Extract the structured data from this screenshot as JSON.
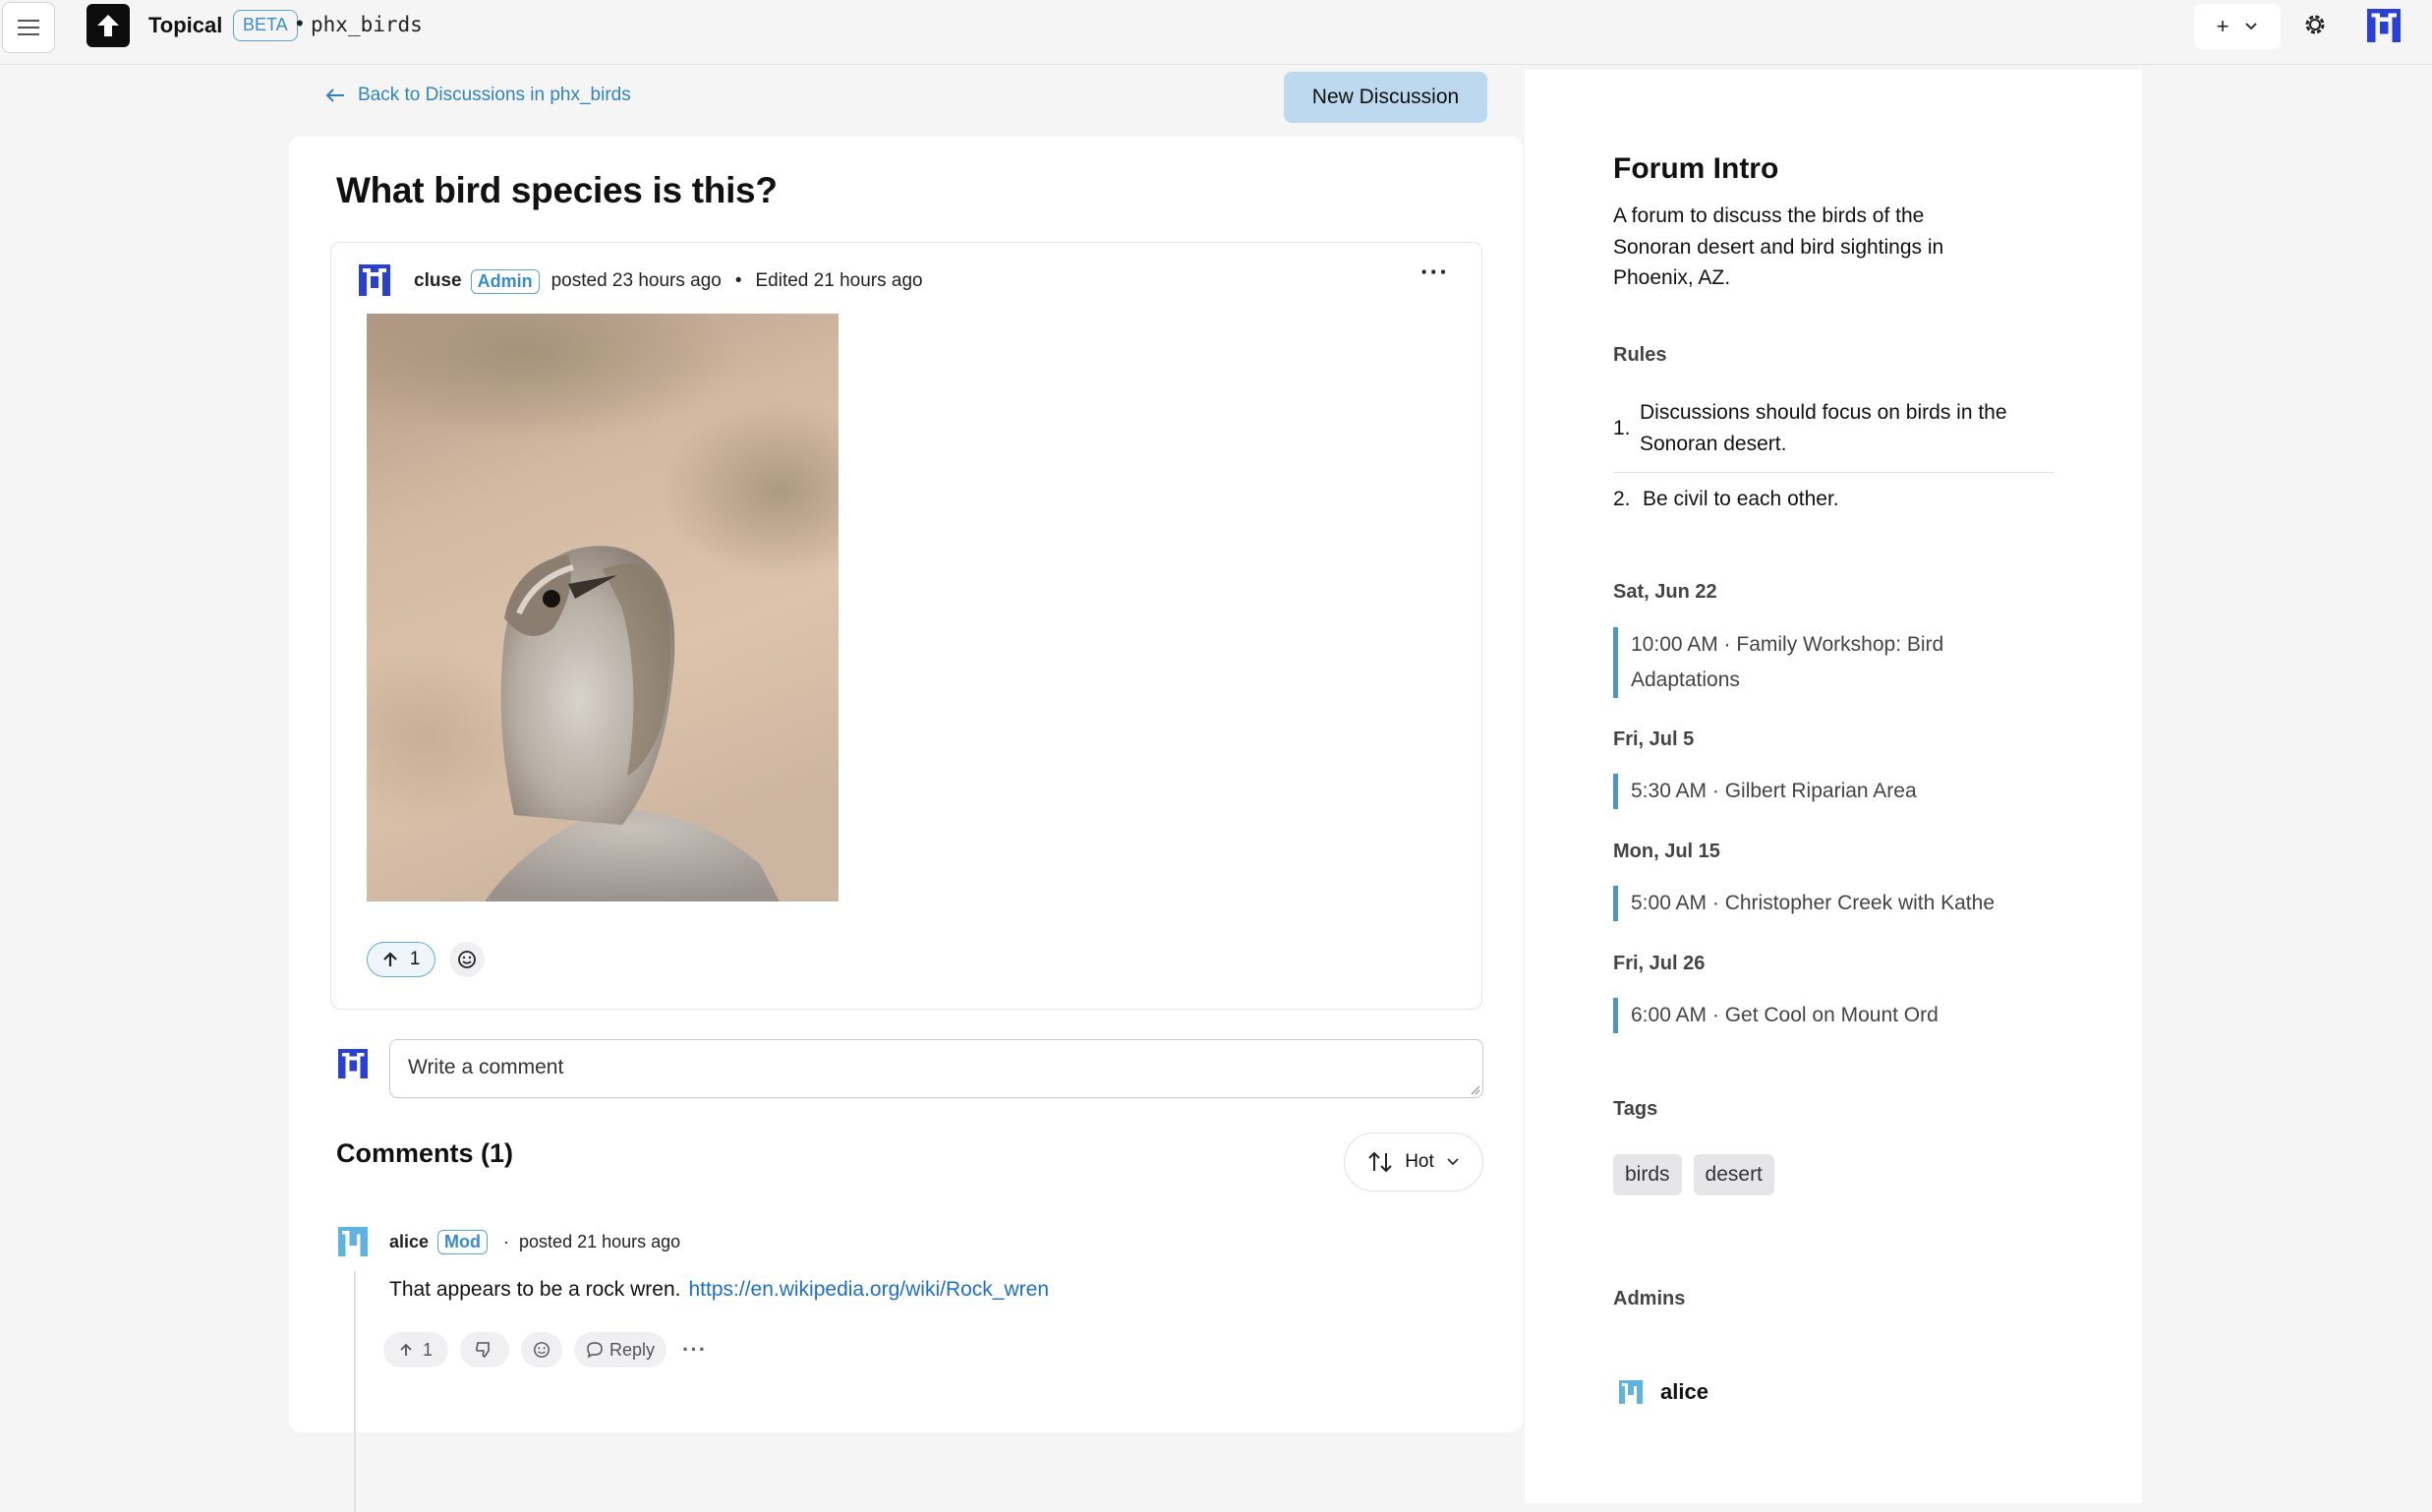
{
  "header": {
    "brand": "Topical",
    "beta": "BETA",
    "separator": "•",
    "forum": "phx_birds",
    "plus": "+",
    "icons": [
      "menu-icon",
      "upload-arrow-icon",
      "chevron-down-icon",
      "gear-icon",
      "pixel-avatar-icon"
    ]
  },
  "nav": {
    "back_label": "Back to Discussions in phx_birds",
    "new_discussion": "New Discussion"
  },
  "post": {
    "title": "What bird species is this?",
    "author": "cluse",
    "author_badge": "Admin",
    "posted": "posted 23 hours ago",
    "separator": "•",
    "edited": "Edited 21 hours ago",
    "more": "···",
    "image_subject": "rock wren photo",
    "upvotes": "1"
  },
  "comment_box": {
    "placeholder": "Write a comment"
  },
  "comments": {
    "heading": "Comments (1)",
    "sort_label": "Hot",
    "items": [
      {
        "author": "alice",
        "badge": "Mod",
        "separator": "·",
        "posted": "posted 21 hours ago",
        "text": "That appears to be a rock wren.",
        "link": "https://en.wikipedia.org/wiki/Rock_wren",
        "upvotes": "1",
        "reply_label": "Reply",
        "more": "···"
      }
    ]
  },
  "sidebar": {
    "intro_title": "Forum Intro",
    "intro_text": "A forum to discuss the birds of the Sonoran desert and bird sightings in Phoenix, AZ.",
    "rules_title": "Rules",
    "rules": [
      {
        "num": "1.",
        "text": "Discussions should focus on birds in the Sonoran desert."
      },
      {
        "num": "2.",
        "text": "Be civil to each other."
      }
    ],
    "events": [
      {
        "day": "Sat, Jun 22",
        "text": "10:00 AM · Family Workshop: Bird Adaptations"
      },
      {
        "day": "Fri, Jul 5",
        "text": "5:30 AM · Gilbert Riparian Area"
      },
      {
        "day": "Mon, Jul 15",
        "text": "5:00 AM · Christopher Creek with Kathe"
      },
      {
        "day": "Fri, Jul 26",
        "text": "6:00 AM · Get Cool on Mount Ord"
      }
    ],
    "tags_title": "Tags",
    "tags": [
      "birds",
      "desert"
    ],
    "admins_title": "Admins",
    "admins": [
      "alice"
    ]
  },
  "colors": {
    "accent": "#3a8cc4",
    "link": "#1f6fbf",
    "button_bg": "#bcd9ef",
    "avatar_blue": "#2a3fd6",
    "avatar_teal": "#5fb3e0",
    "event_bar": "#4a94d0"
  }
}
